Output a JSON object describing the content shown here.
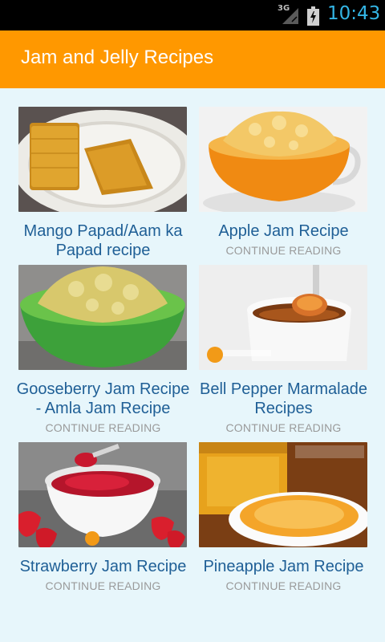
{
  "status": {
    "network": "3G",
    "time": "10:43"
  },
  "app": {
    "title": "Jam and Jelly Recipes"
  },
  "recipes": [
    {
      "title": "Mango Papad/Aam ka Papad recipe",
      "more": ""
    },
    {
      "title": "Apple Jam Recipe",
      "more": "CONTINUE READING"
    },
    {
      "title": "Gooseberry Jam Recipe - Amla Jam Recipe",
      "more": "CONTINUE READING"
    },
    {
      "title": "Bell Pepper Marmalade Recipes",
      "more": "CONTINUE READING"
    },
    {
      "title": "Strawberry Jam Recipe",
      "more": "CONTINUE READING"
    },
    {
      "title": "Pineapple Jam Recipe",
      "more": "CONTINUE READING"
    }
  ],
  "colors": {
    "appbar": "#ff9800",
    "title": "#1f5f96",
    "status_time": "#33b5e5",
    "background": "#e7f6fb"
  }
}
